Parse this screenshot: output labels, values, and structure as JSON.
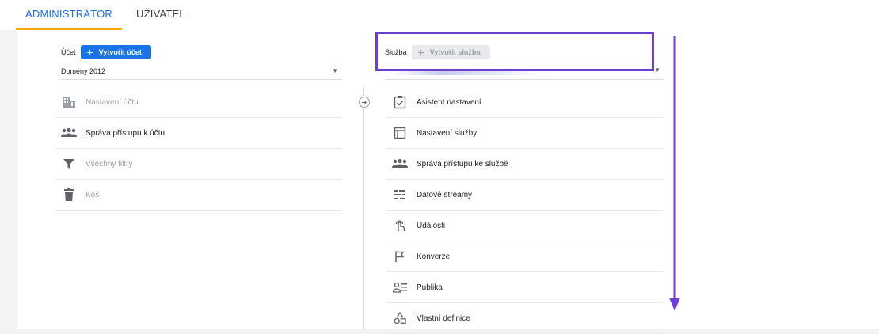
{
  "tabs": [
    {
      "label": "ADMINISTRÁTOR",
      "active": true
    },
    {
      "label": "UŽIVATEL",
      "active": false
    }
  ],
  "account": {
    "label": "Účet",
    "create_button": "Vytvořit účet",
    "selected": "Domény 2012",
    "menu": [
      {
        "label": "Nastavení účtu",
        "icon": "building-icon",
        "enabled": false
      },
      {
        "label": "Správa přístupu k účtu",
        "icon": "people-icon",
        "enabled": true
      },
      {
        "label": "Všechny filtry",
        "icon": "filter-icon",
        "enabled": false
      },
      {
        "label": "Koš",
        "icon": "trash-icon",
        "enabled": false
      }
    ]
  },
  "property": {
    "label": "Služba",
    "create_button": "Vytvořit službu",
    "menu": [
      {
        "label": "Asistent nastavení",
        "icon": "checklist-icon"
      },
      {
        "label": "Nastavení služby",
        "icon": "property-settings-icon"
      },
      {
        "label": "Správa přístupu ke službě",
        "icon": "people-icon"
      },
      {
        "label": "Datové streamy",
        "icon": "streams-icon"
      },
      {
        "label": "Události",
        "icon": "touch-icon"
      },
      {
        "label": "Konverze",
        "icon": "flag-icon"
      },
      {
        "label": "Publika",
        "icon": "audience-icon"
      },
      {
        "label": "Vlastní definice",
        "icon": "shapes-icon"
      }
    ]
  },
  "colors": {
    "accent": "#1a73e8",
    "tab_underline": "#f9ab00",
    "annotation": "#6b3fd4"
  }
}
